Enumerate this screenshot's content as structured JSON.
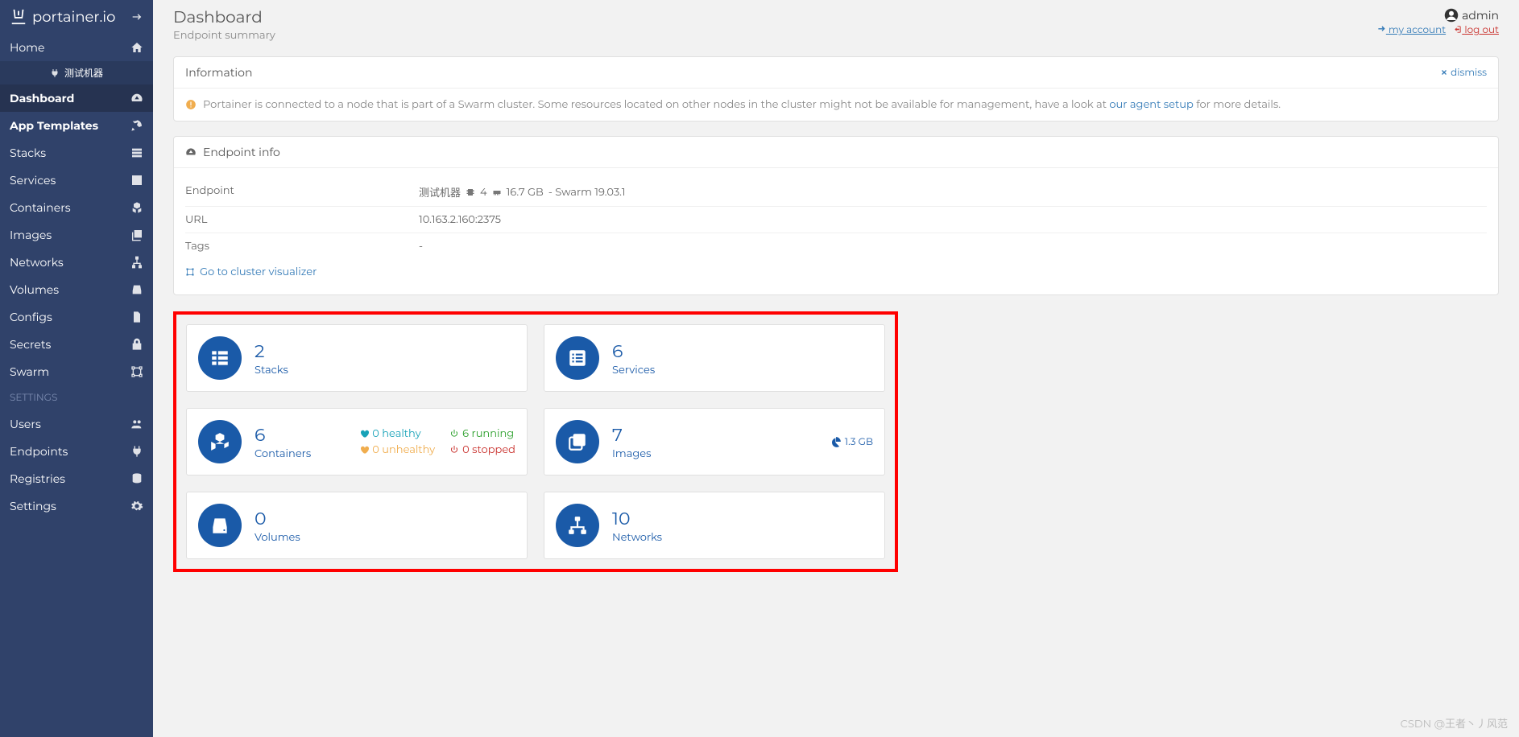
{
  "brand": "portainer.io",
  "header": {
    "title": "Dashboard",
    "subtitle": "Endpoint summary"
  },
  "user": {
    "name": "admin",
    "my_account": "my account",
    "log_out": "log out"
  },
  "endpoint_label": "测试机器",
  "sidebar": {
    "home": "Home",
    "items": [
      {
        "label": "Dashboard"
      },
      {
        "label": "App Templates"
      },
      {
        "label": "Stacks"
      },
      {
        "label": "Services"
      },
      {
        "label": "Containers"
      },
      {
        "label": "Images"
      },
      {
        "label": "Networks"
      },
      {
        "label": "Volumes"
      },
      {
        "label": "Configs"
      },
      {
        "label": "Secrets"
      },
      {
        "label": "Swarm"
      }
    ],
    "settings_label": "SETTINGS",
    "settings": [
      {
        "label": "Users"
      },
      {
        "label": "Endpoints"
      },
      {
        "label": "Registries"
      },
      {
        "label": "Settings"
      }
    ]
  },
  "info_panel": {
    "title": "Information",
    "dismiss": "dismiss",
    "notice_pre": "Portainer is connected to a node that is part of a Swarm cluster. Some resources located on other nodes in the cluster might not be available for management, have a look at ",
    "notice_link": "our agent setup",
    "notice_post": " for more details."
  },
  "endpoint_panel": {
    "title": "Endpoint info",
    "rows": {
      "endpoint_key": "Endpoint",
      "endpoint_name": "测试机器",
      "cpu": "4",
      "mem": "16.7 GB",
      "swarm": "- Swarm 19.03.1",
      "url_key": "URL",
      "url_val": "10.163.2.160:2375",
      "tags_key": "Tags",
      "tags_val": "-"
    },
    "cluster_link": "Go to cluster visualizer"
  },
  "tiles": {
    "stacks": {
      "count": "2",
      "label": "Stacks"
    },
    "services": {
      "count": "6",
      "label": "Services"
    },
    "containers": {
      "count": "6",
      "label": "Containers",
      "healthy": "0 healthy",
      "running": "6 running",
      "unhealthy": "0 unhealthy",
      "stopped": "0 stopped"
    },
    "images": {
      "count": "7",
      "label": "Images",
      "size": "1.3 GB"
    },
    "volumes": {
      "count": "0",
      "label": "Volumes"
    },
    "networks": {
      "count": "10",
      "label": "Networks"
    }
  },
  "watermark": "CSDN @王者丶丿风范"
}
